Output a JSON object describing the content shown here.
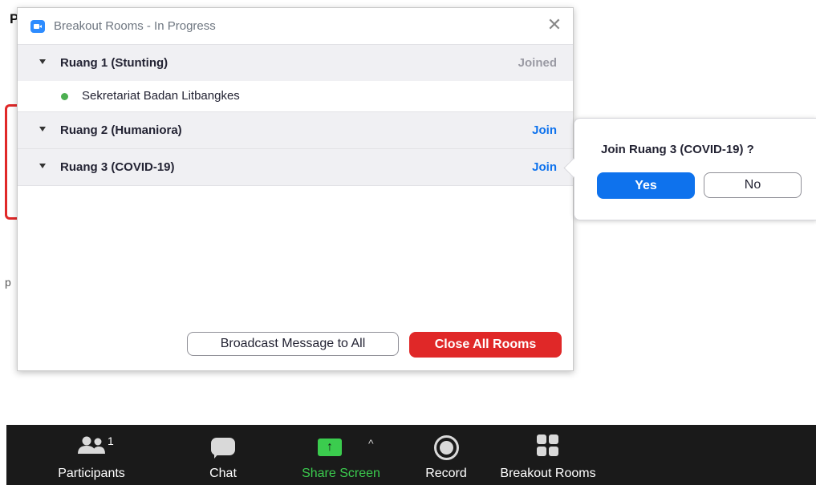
{
  "background": {
    "letter_top": "P",
    "letter_mid": "p"
  },
  "dialog": {
    "title": "Breakout Rooms - In Progress",
    "rooms": [
      {
        "name": "Ruang 1 (Stunting)",
        "action": "Joined",
        "members": [
          "Sekretariat Badan Litbangkes"
        ]
      },
      {
        "name": "Ruang 2 (Humaniora)",
        "action": "Join"
      },
      {
        "name": "Ruang 3 (COVID-19)",
        "action": "Join"
      }
    ],
    "broadcast_label": "Broadcast Message to All",
    "close_all_label": "Close All Rooms"
  },
  "popover": {
    "question": "Join Ruang 3 (COVID-19) ?",
    "yes_label": "Yes",
    "no_label": "No"
  },
  "toolbar": {
    "participants_label": "Participants",
    "participants_count": "1",
    "chat_label": "Chat",
    "share_label": "Share Screen",
    "record_label": "Record",
    "breakout_label": "Breakout Rooms"
  },
  "colors": {
    "accent_blue": "#0e72ed",
    "danger_red": "#e02828",
    "share_green": "#3bcc4e",
    "toolbar_bg": "#1a1a1a"
  }
}
